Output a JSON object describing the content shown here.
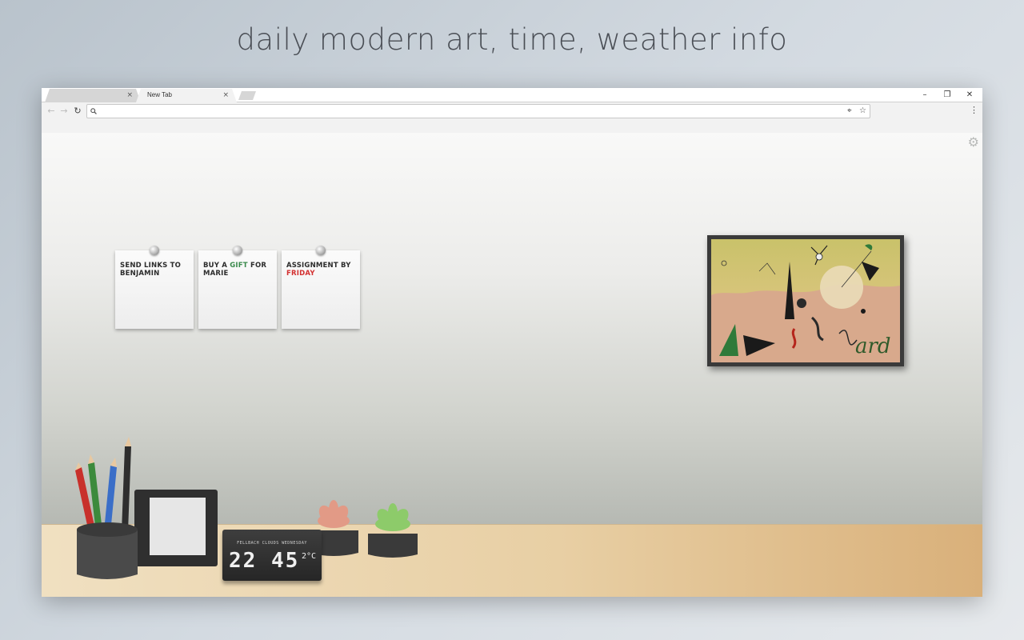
{
  "promo": {
    "title": "daily modern art, time, weather info"
  },
  "browser": {
    "tabs": [
      {
        "label": "",
        "close": "×"
      },
      {
        "label": "New Tab",
        "close": "×"
      }
    ],
    "window_controls": {
      "minimize": "–",
      "restore": "❐",
      "close": "✕"
    },
    "toolbar": {
      "back": "←",
      "forward": "→",
      "reload": "↻",
      "omnibox_value": "",
      "location_icon": "⌖",
      "bookmark_icon": "☆",
      "menu": "⋮"
    }
  },
  "page": {
    "settings_icon": "⚙",
    "notes": [
      {
        "parts": [
          {
            "text": "SEND LINKS TO BENJAMIN",
            "style": "plain"
          }
        ]
      },
      {
        "parts": [
          {
            "text": "BUY A ",
            "style": "plain"
          },
          {
            "text": "GIFT",
            "style": "green"
          },
          {
            "text": " FOR MARIE",
            "style": "plain"
          }
        ]
      },
      {
        "parts": [
          {
            "text": "ASSIGNMENT BY ",
            "style": "plain"
          },
          {
            "text": "FRIDAY",
            "style": "red"
          }
        ]
      }
    ],
    "clock": {
      "info_line": "FELLBACH CLOUDS WEDNESDAY",
      "time": "22 45",
      "temperature": "2°C"
    }
  },
  "colors": {
    "note_green": "#3a8a4c",
    "note_red": "#d33030"
  }
}
